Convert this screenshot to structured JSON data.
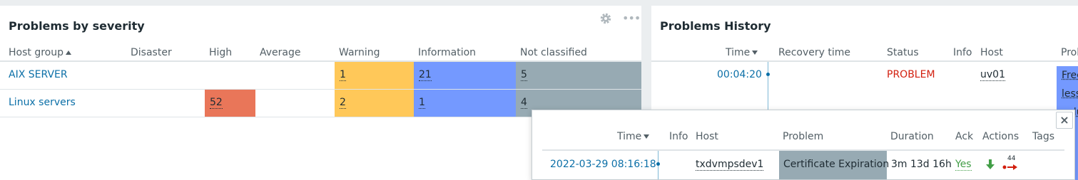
{
  "severity_widget": {
    "title": "Problems by severity",
    "headers": {
      "host_group": "Host group",
      "disaster": "Disaster",
      "high": "High",
      "average": "Average",
      "warning": "Warning",
      "information": "Information",
      "not_classified": "Not classified"
    },
    "rows": [
      {
        "group": "AIX SERVER",
        "warning": "1",
        "information": "21",
        "not_classified": "5"
      },
      {
        "group": "Linux servers",
        "high": "52",
        "warning": "2",
        "information": "1",
        "not_classified": "4"
      }
    ],
    "icons": {
      "settings": "gear-icon",
      "menu": "more-dots-icon"
    }
  },
  "history_widget": {
    "title": "Problems History",
    "headers": {
      "time": "Time",
      "recovery_time": "Recovery time",
      "status": "Status",
      "info": "Info",
      "host": "Host",
      "problem": "Prol"
    },
    "rows": [
      {
        "time": "00:04:20",
        "status": "PROBLEM",
        "host": "uv01",
        "problem_fragments": [
          "Free",
          "less",
          "volu"
        ]
      }
    ]
  },
  "popup": {
    "headers": {
      "time": "Time",
      "info": "Info",
      "host": "Host",
      "problem": "Problem",
      "duration": "Duration",
      "ack": "Ack",
      "actions": "Actions",
      "tags": "Tags"
    },
    "row": {
      "time": "2022-03-29 08:16:18",
      "host": "txdvmpsdev1",
      "problem": "Certificate Expiration",
      "duration": "3m 13d 16h",
      "ack": "Yes",
      "actions_count": "44"
    },
    "close_label": "×"
  },
  "colors": {
    "high": "#e97659",
    "warning": "#ffc859",
    "information": "#7499ff",
    "not_classified": "#97aab3",
    "link": "#0b6fa7",
    "problem": "#d21f0e",
    "ack_yes": "#429e47"
  }
}
